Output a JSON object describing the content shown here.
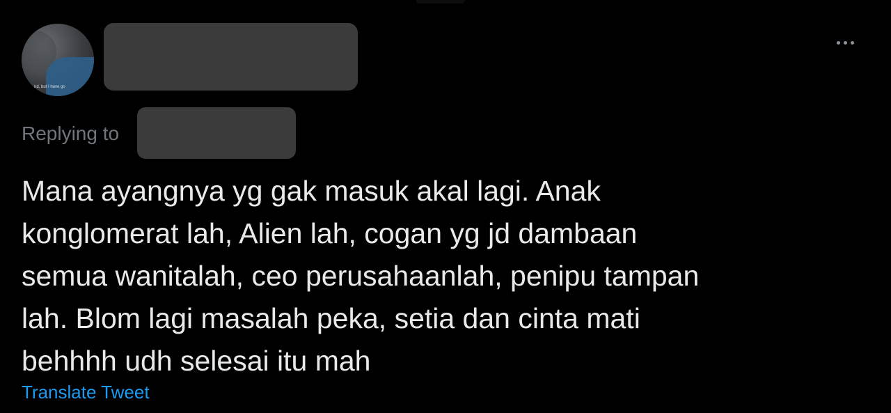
{
  "tweet": {
    "avatar_caption": "nd, but I have go",
    "replying_label": "Replying to",
    "text_lines": [
      "Mana ayangnya yg gak masuk akal lagi. Anak",
      "konglomerat lah, Alien lah, cogan yg jd dambaan",
      "semua wanitalah, ceo perusahaanlah, penipu tampan",
      "lah. Blom lagi masalah peka, setia dan cinta mati",
      "behhhh udh selesai itu mah"
    ],
    "translate_label": "Translate Tweet",
    "more_icon": "more-horizontal-icon"
  },
  "colors": {
    "background": "#000000",
    "text": "#e7e9ea",
    "secondary_text": "#71767b",
    "link": "#1d9bf0",
    "redaction": "#3b3b3b"
  }
}
